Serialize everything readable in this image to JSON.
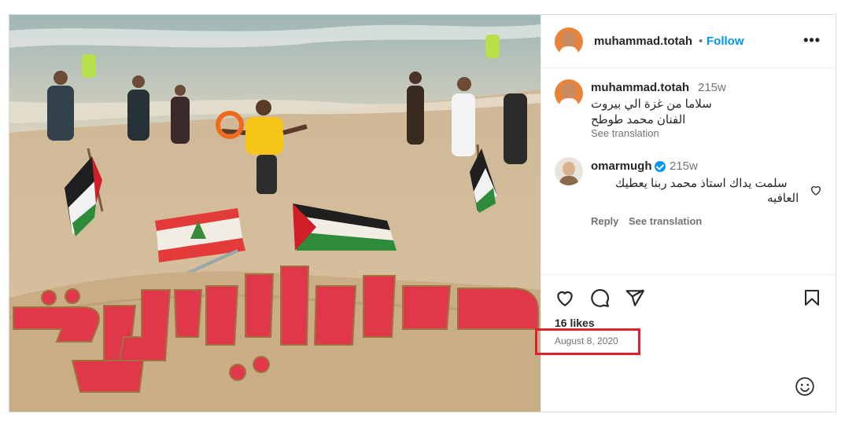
{
  "post": {
    "author": "muhammad.totah",
    "follow_label": "Follow",
    "separator": "•",
    "more_label": "•••",
    "sand_art_text": "سلاما بيروت"
  },
  "comments": [
    {
      "user": "muhammad.totah",
      "time": "215w",
      "text_line1": "سلاما من غزة الي بيروت",
      "text_line2": "الفنان محمد طوطح",
      "see_translation": "See translation"
    },
    {
      "user": "omarmugh",
      "time": "215w",
      "verified": true,
      "text_line1": "سلمت يداك استاذ محمد ربنا يعطيك",
      "text_line2": "العافيه",
      "reply": "Reply",
      "see_translation": "See translation"
    }
  ],
  "engagement": {
    "likes": "16 likes",
    "date": "August 8, 2020"
  },
  "colors": {
    "link": "#0095f6",
    "muted": "#737373",
    "highlight": "#e0202a"
  },
  "icons": [
    "more-icon",
    "heart-icon",
    "comment-icon",
    "share-icon",
    "bookmark-icon",
    "emoji-icon",
    "verified-icon"
  ]
}
